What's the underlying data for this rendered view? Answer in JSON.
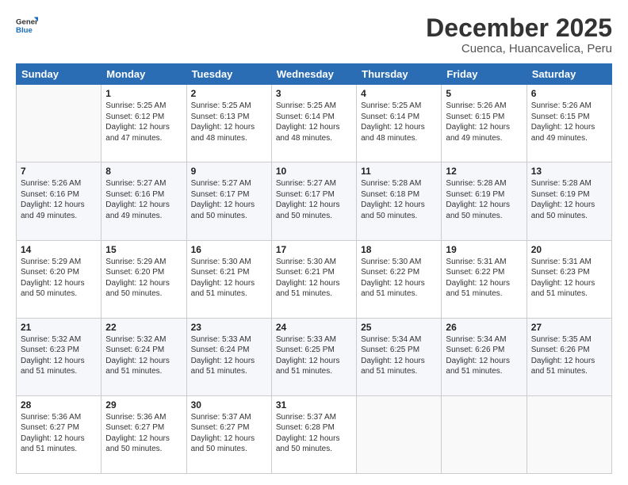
{
  "logo": {
    "line1": "General",
    "line2": "Blue"
  },
  "title": "December 2025",
  "subtitle": "Cuenca, Huancavelica, Peru",
  "days_of_week": [
    "Sunday",
    "Monday",
    "Tuesday",
    "Wednesday",
    "Thursday",
    "Friday",
    "Saturday"
  ],
  "weeks": [
    [
      {
        "day": "",
        "text": ""
      },
      {
        "day": "1",
        "text": "Sunrise: 5:25 AM\nSunset: 6:12 PM\nDaylight: 12 hours\nand 47 minutes."
      },
      {
        "day": "2",
        "text": "Sunrise: 5:25 AM\nSunset: 6:13 PM\nDaylight: 12 hours\nand 48 minutes."
      },
      {
        "day": "3",
        "text": "Sunrise: 5:25 AM\nSunset: 6:14 PM\nDaylight: 12 hours\nand 48 minutes."
      },
      {
        "day": "4",
        "text": "Sunrise: 5:25 AM\nSunset: 6:14 PM\nDaylight: 12 hours\nand 48 minutes."
      },
      {
        "day": "5",
        "text": "Sunrise: 5:26 AM\nSunset: 6:15 PM\nDaylight: 12 hours\nand 49 minutes."
      },
      {
        "day": "6",
        "text": "Sunrise: 5:26 AM\nSunset: 6:15 PM\nDaylight: 12 hours\nand 49 minutes."
      }
    ],
    [
      {
        "day": "7",
        "text": "Sunrise: 5:26 AM\nSunset: 6:16 PM\nDaylight: 12 hours\nand 49 minutes."
      },
      {
        "day": "8",
        "text": "Sunrise: 5:27 AM\nSunset: 6:16 PM\nDaylight: 12 hours\nand 49 minutes."
      },
      {
        "day": "9",
        "text": "Sunrise: 5:27 AM\nSunset: 6:17 PM\nDaylight: 12 hours\nand 50 minutes."
      },
      {
        "day": "10",
        "text": "Sunrise: 5:27 AM\nSunset: 6:17 PM\nDaylight: 12 hours\nand 50 minutes."
      },
      {
        "day": "11",
        "text": "Sunrise: 5:28 AM\nSunset: 6:18 PM\nDaylight: 12 hours\nand 50 minutes."
      },
      {
        "day": "12",
        "text": "Sunrise: 5:28 AM\nSunset: 6:19 PM\nDaylight: 12 hours\nand 50 minutes."
      },
      {
        "day": "13",
        "text": "Sunrise: 5:28 AM\nSunset: 6:19 PM\nDaylight: 12 hours\nand 50 minutes."
      }
    ],
    [
      {
        "day": "14",
        "text": "Sunrise: 5:29 AM\nSunset: 6:20 PM\nDaylight: 12 hours\nand 50 minutes."
      },
      {
        "day": "15",
        "text": "Sunrise: 5:29 AM\nSunset: 6:20 PM\nDaylight: 12 hours\nand 50 minutes."
      },
      {
        "day": "16",
        "text": "Sunrise: 5:30 AM\nSunset: 6:21 PM\nDaylight: 12 hours\nand 51 minutes."
      },
      {
        "day": "17",
        "text": "Sunrise: 5:30 AM\nSunset: 6:21 PM\nDaylight: 12 hours\nand 51 minutes."
      },
      {
        "day": "18",
        "text": "Sunrise: 5:30 AM\nSunset: 6:22 PM\nDaylight: 12 hours\nand 51 minutes."
      },
      {
        "day": "19",
        "text": "Sunrise: 5:31 AM\nSunset: 6:22 PM\nDaylight: 12 hours\nand 51 minutes."
      },
      {
        "day": "20",
        "text": "Sunrise: 5:31 AM\nSunset: 6:23 PM\nDaylight: 12 hours\nand 51 minutes."
      }
    ],
    [
      {
        "day": "21",
        "text": "Sunrise: 5:32 AM\nSunset: 6:23 PM\nDaylight: 12 hours\nand 51 minutes."
      },
      {
        "day": "22",
        "text": "Sunrise: 5:32 AM\nSunset: 6:24 PM\nDaylight: 12 hours\nand 51 minutes."
      },
      {
        "day": "23",
        "text": "Sunrise: 5:33 AM\nSunset: 6:24 PM\nDaylight: 12 hours\nand 51 minutes."
      },
      {
        "day": "24",
        "text": "Sunrise: 5:33 AM\nSunset: 6:25 PM\nDaylight: 12 hours\nand 51 minutes."
      },
      {
        "day": "25",
        "text": "Sunrise: 5:34 AM\nSunset: 6:25 PM\nDaylight: 12 hours\nand 51 minutes."
      },
      {
        "day": "26",
        "text": "Sunrise: 5:34 AM\nSunset: 6:26 PM\nDaylight: 12 hours\nand 51 minutes."
      },
      {
        "day": "27",
        "text": "Sunrise: 5:35 AM\nSunset: 6:26 PM\nDaylight: 12 hours\nand 51 minutes."
      }
    ],
    [
      {
        "day": "28",
        "text": "Sunrise: 5:36 AM\nSunset: 6:27 PM\nDaylight: 12 hours\nand 51 minutes."
      },
      {
        "day": "29",
        "text": "Sunrise: 5:36 AM\nSunset: 6:27 PM\nDaylight: 12 hours\nand 50 minutes."
      },
      {
        "day": "30",
        "text": "Sunrise: 5:37 AM\nSunset: 6:27 PM\nDaylight: 12 hours\nand 50 minutes."
      },
      {
        "day": "31",
        "text": "Sunrise: 5:37 AM\nSunset: 6:28 PM\nDaylight: 12 hours\nand 50 minutes."
      },
      {
        "day": "",
        "text": ""
      },
      {
        "day": "",
        "text": ""
      },
      {
        "day": "",
        "text": ""
      }
    ]
  ]
}
